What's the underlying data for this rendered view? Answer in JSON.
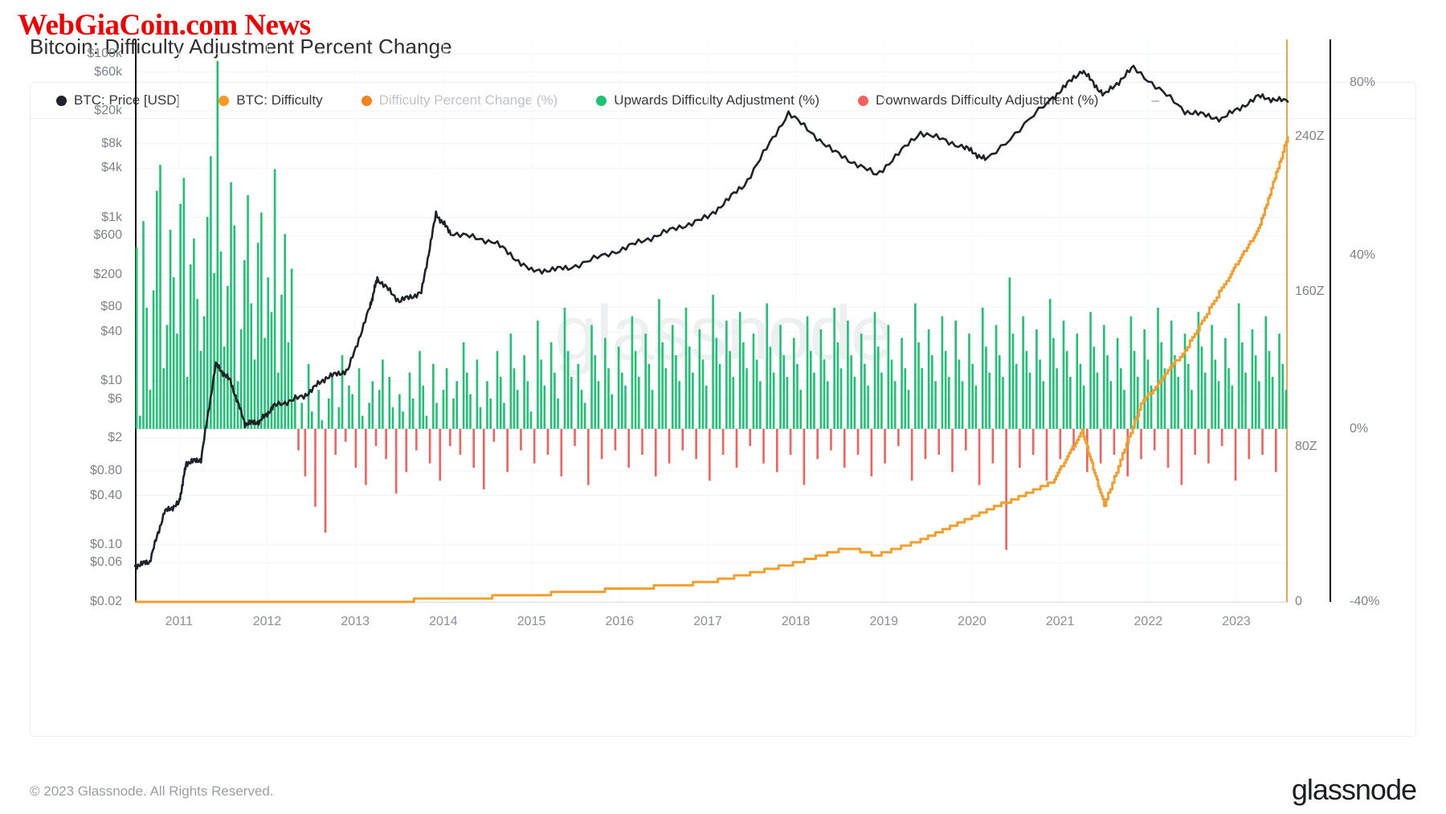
{
  "header": {
    "title": "Bitcoin: Difficulty Adjustment Percent Change",
    "watermark": "WebGiaCoin.com News",
    "watermark_color": "#ee0000"
  },
  "center_watermark": "glassnode",
  "footer": {
    "copyright": "© 2023 Glassnode. All Rights Reserved.",
    "logo": "glassnode"
  },
  "legend": {
    "items": [
      {
        "label": "BTC: Price [USD]",
        "color": "#1f2227",
        "muted": false
      },
      {
        "label": "BTC: Difficulty",
        "color": "#f59b1f",
        "muted": false
      },
      {
        "label": "Difficulty Percent Change (%)",
        "color": "#f5821f",
        "muted": true
      },
      {
        "label": "Upwards Difficulty Adjustment (%)",
        "color": "#1fc274",
        "muted": false
      },
      {
        "label": "Downwards Difficulty Adjustment (%)",
        "color": "#f4605c",
        "muted": false
      }
    ],
    "trailing": "–"
  },
  "chart_data": {
    "type": "line",
    "title": "Bitcoin: Difficulty Adjustment Percent Change",
    "xlabel": "",
    "ylabel": "BTC: Price [USD]",
    "grid": true,
    "legend_position": "top",
    "x_axis": {
      "ticks": [
        "2011",
        "2012",
        "2013",
        "2014",
        "2015",
        "2016",
        "2017",
        "2018",
        "2019",
        "2020",
        "2021",
        "2022",
        "2023"
      ],
      "range": [
        "2010-07",
        "2023-08"
      ]
    },
    "y_axis_left": {
      "label": "BTC: Price [USD]",
      "scale": "log",
      "ticks": [
        "$100k",
        "$60k",
        "$20k",
        "$8k",
        "$4k",
        "$1k",
        "$600",
        "$200",
        "$80",
        "$40",
        "$10",
        "$6",
        "$2",
        "$0.80",
        "$0.40",
        "$0.10",
        "$0.06",
        "$0.02"
      ],
      "tick_values": [
        100000,
        60000,
        20000,
        8000,
        4000,
        1000,
        600,
        200,
        80,
        40,
        10,
        6,
        2,
        0.8,
        0.4,
        0.1,
        0.06,
        0.02
      ],
      "ylim": [
        0.02,
        150000
      ]
    },
    "y_axis_right_difficulty": {
      "label": "BTC: Difficulty",
      "ticks": [
        "240Z",
        "160Z",
        "80Z",
        "0"
      ],
      "tick_values": [
        240,
        160,
        80,
        0
      ],
      "ylim": [
        0,
        290
      ]
    },
    "y_axis_right_percent": {
      "label": "Difficulty Percent Change (%)",
      "ticks": [
        "80%",
        "40%",
        "0%",
        "-40%"
      ],
      "tick_values": [
        80,
        40,
        0,
        -40
      ],
      "ylim": [
        -40,
        90
      ]
    },
    "series": [
      {
        "name": "BTC: Price [USD]",
        "type": "line",
        "color": "#1f2227",
        "axis": "left",
        "unit": "USD",
        "points": [
          {
            "x": "2010-07",
            "y": 0.055
          },
          {
            "x": "2010-09",
            "y": 0.062
          },
          {
            "x": "2010-11",
            "y": 0.25
          },
          {
            "x": "2011-01",
            "y": 0.32
          },
          {
            "x": "2011-02",
            "y": 1.0
          },
          {
            "x": "2011-04",
            "y": 1.1
          },
          {
            "x": "2011-06",
            "y": 16.0
          },
          {
            "x": "2011-08",
            "y": 10.0
          },
          {
            "x": "2011-10",
            "y": 3.0
          },
          {
            "x": "2011-12",
            "y": 3.2
          },
          {
            "x": "2012-02",
            "y": 5.0
          },
          {
            "x": "2012-06",
            "y": 6.5
          },
          {
            "x": "2012-09",
            "y": 11.0
          },
          {
            "x": "2012-12",
            "y": 13.5
          },
          {
            "x": "2013-03",
            "y": 80.0
          },
          {
            "x": "2013-04",
            "y": 180.0
          },
          {
            "x": "2013-07",
            "y": 95.0
          },
          {
            "x": "2013-10",
            "y": 120.0
          },
          {
            "x": "2013-12",
            "y": 1100.0
          },
          {
            "x": "2014-02",
            "y": 650.0
          },
          {
            "x": "2014-08",
            "y": 500.0
          },
          {
            "x": "2015-01",
            "y": 220.0
          },
          {
            "x": "2015-06",
            "y": 240.0
          },
          {
            "x": "2016-01",
            "y": 400.0
          },
          {
            "x": "2016-07",
            "y": 650.0
          },
          {
            "x": "2017-01",
            "y": 1000.0
          },
          {
            "x": "2017-06",
            "y": 2500.0
          },
          {
            "x": "2017-12",
            "y": 19000.0
          },
          {
            "x": "2018-06",
            "y": 6500.0
          },
          {
            "x": "2018-12",
            "y": 3300.0
          },
          {
            "x": "2019-06",
            "y": 11000.0
          },
          {
            "x": "2019-12",
            "y": 7200.0
          },
          {
            "x": "2020-03",
            "y": 5000.0
          },
          {
            "x": "2020-12",
            "y": 29000.0
          },
          {
            "x": "2021-04",
            "y": 63000.0
          },
          {
            "x": "2021-07",
            "y": 31000.0
          },
          {
            "x": "2021-11",
            "y": 68000.0
          },
          {
            "x": "2022-06",
            "y": 20000.0
          },
          {
            "x": "2022-11",
            "y": 16000.0
          },
          {
            "x": "2023-04",
            "y": 30000.0
          },
          {
            "x": "2023-08",
            "y": 26000.0
          }
        ]
      },
      {
        "name": "BTC: Difficulty",
        "type": "line",
        "color": "#f0a030",
        "axis": "right-difficulty",
        "unit": "Z",
        "points": [
          {
            "x": "2010-07",
            "y": 0.0
          },
          {
            "x": "2013-01",
            "y": 0.2
          },
          {
            "x": "2014-01",
            "y": 1.2
          },
          {
            "x": "2015-01",
            "y": 3.8
          },
          {
            "x": "2016-01",
            "y": 6.5
          },
          {
            "x": "2017-01",
            "y": 10.0
          },
          {
            "x": "2017-06",
            "y": 14.0
          },
          {
            "x": "2018-01",
            "y": 20.0
          },
          {
            "x": "2018-08",
            "y": 28.0
          },
          {
            "x": "2018-12",
            "y": 24.0
          },
          {
            "x": "2019-06",
            "y": 32.0
          },
          {
            "x": "2019-12",
            "y": 42.0
          },
          {
            "x": "2020-06",
            "y": 52.0
          },
          {
            "x": "2020-12",
            "y": 62.0
          },
          {
            "x": "2021-04",
            "y": 88.0
          },
          {
            "x": "2021-07",
            "y": 50.0
          },
          {
            "x": "2021-12",
            "y": 102.0
          },
          {
            "x": "2022-06",
            "y": 130.0
          },
          {
            "x": "2022-12",
            "y": 168.0
          },
          {
            "x": "2023-04",
            "y": 192.0
          },
          {
            "x": "2023-08",
            "y": 240.0
          }
        ]
      },
      {
        "name": "Upwards Difficulty Adjustment (%)",
        "type": "bar",
        "color": "#1fc274",
        "axis": "right-percent",
        "note": "positive difficulty adjustment epochs, values 0% to ~90%"
      },
      {
        "name": "Downwards Difficulty Adjustment (%)",
        "type": "bar",
        "color": "#f4605c",
        "axis": "right-percent",
        "note": "negative difficulty adjustment epochs, values 0% to ~-28%"
      }
    ],
    "bars": {
      "up_color": "#1fc274",
      "down_color": "#f4605c",
      "values": [
        42,
        3,
        48,
        28,
        9,
        32,
        55,
        61,
        14,
        24,
        46,
        35,
        22,
        52,
        58,
        12,
        38,
        44,
        30,
        18,
        26,
        49,
        63,
        36,
        85,
        41,
        19,
        33,
        57,
        47,
        11,
        23,
        39,
        54,
        29,
        16,
        43,
        50,
        21,
        35,
        27,
        60,
        13,
        31,
        45,
        20,
        37,
        8,
        -5,
        6,
        -11,
        15,
        4,
        -18,
        9,
        2,
        -24,
        7,
        12,
        -6,
        5,
        17,
        -3,
        10,
        8,
        -9,
        14,
        3,
        -13,
        6,
        11,
        -4,
        9,
        16,
        -7,
        12,
        5,
        -15,
        8,
        4,
        -10,
        13,
        7,
        -5,
        18,
        10,
        3,
        -8,
        15,
        6,
        -12,
        9,
        14,
        -4,
        7,
        11,
        -6,
        20,
        13,
        8,
        -9,
        16,
        5,
        -14,
        11,
        7,
        -3,
        18,
        12,
        6,
        -10,
        22,
        14,
        9,
        -5,
        17,
        11,
        4,
        -8,
        25,
        16,
        10,
        -6,
        20,
        13,
        7,
        -11,
        28,
        18,
        12,
        -4,
        15,
        9,
        6,
        -13,
        24,
        17,
        11,
        -7,
        21,
        14,
        8,
        -5,
        19,
        13,
        10,
        -9,
        26,
        18,
        12,
        -6,
        22,
        15,
        9,
        -11,
        30,
        20,
        14,
        -8,
        24,
        17,
        11,
        -5,
        28,
        19,
        13,
        -7,
        23,
        16,
        10,
        -12,
        31,
        21,
        15,
        -6,
        25,
        18,
        12,
        -9,
        27,
        20,
        14,
        -4,
        22,
        16,
        11,
        -8,
        29,
        19,
        13,
        -10,
        24,
        17,
        12,
        -6,
        21,
        15,
        9,
        -13,
        26,
        18,
        13,
        -7,
        23,
        16,
        11,
        -5,
        28,
        20,
        14,
        -9,
        25,
        17,
        12,
        -6,
        22,
        15,
        10,
        -11,
        27,
        19,
        13,
        -8,
        24,
        16,
        11,
        -4,
        21,
        14,
        9,
        -12,
        29,
        20,
        14,
        -7,
        23,
        17,
        11,
        -6,
        26,
        18,
        12,
        -10,
        25,
        16,
        11,
        -5,
        22,
        15,
        10,
        -13,
        28,
        19,
        13,
        -8,
        24,
        17,
        12,
        -28,
        35,
        22,
        15,
        -9,
        26,
        18,
        13,
        -6,
        23,
        16,
        11,
        -12,
        30,
        21,
        14,
        -7,
        25,
        18,
        12,
        -5,
        22,
        15,
        10,
        -10,
        27,
        19,
        13,
        -8,
        24,
        17,
        11,
        -6,
        21,
        14,
        9,
        -11,
        26,
        18,
        12,
        -7,
        23,
        16,
        10,
        -5,
        28,
        20,
        14,
        -9,
        25,
        17,
        12,
        -13,
        22,
        15,
        9,
        -6,
        27,
        19,
        13,
        -8,
        24,
        16,
        11,
        -4,
        21,
        14,
        10,
        -12,
        29,
        20,
        13,
        -7,
        23,
        17,
        11,
        -6,
        26,
        18,
        12,
        -10,
        22,
        15,
        9
      ]
    }
  }
}
